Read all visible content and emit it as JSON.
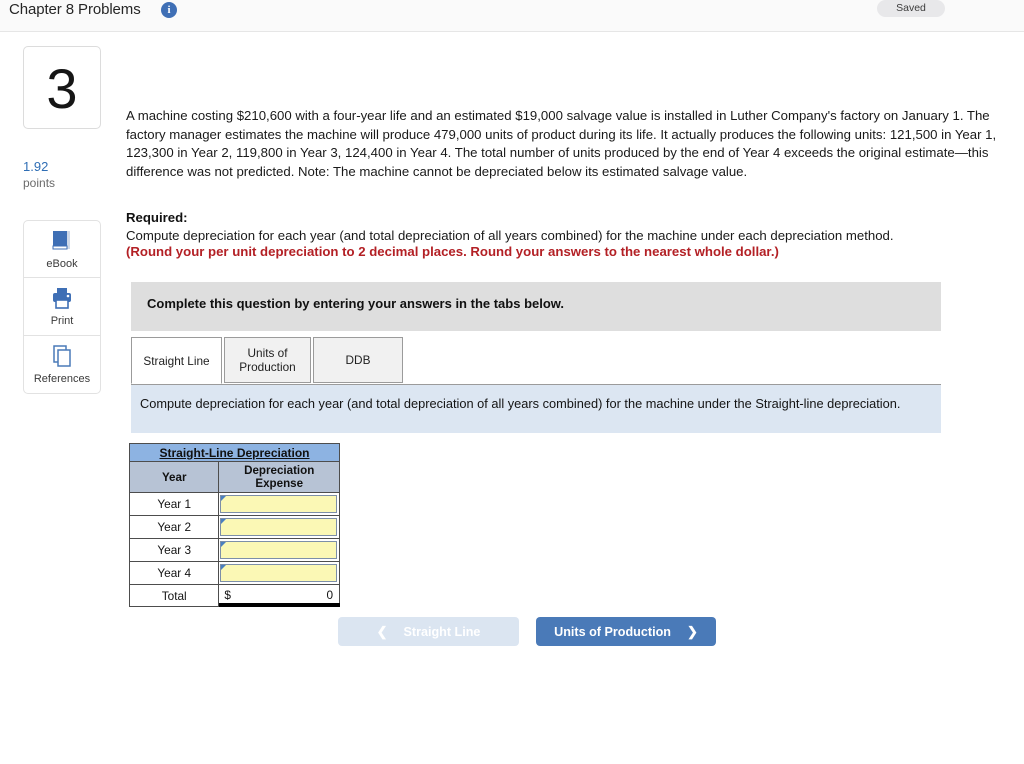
{
  "header": {
    "title": "Chapter 8 Problems",
    "info_icon": "info-icon",
    "saved_label": "Saved"
  },
  "sidebar": {
    "question_number": "3",
    "points_value": "1.92",
    "points_label": "points",
    "buttons": [
      {
        "label": "eBook",
        "icon": "book-icon"
      },
      {
        "label": "Print",
        "icon": "printer-icon"
      },
      {
        "label": "References",
        "icon": "copy-pages-icon"
      }
    ]
  },
  "question": {
    "body": "A machine costing $210,600 with a four-year life and an estimated $19,000 salvage value is installed in Luther Company's factory on January 1. The factory manager estimates the machine will produce 479,000 units of product during its life. It actually produces the following units: 121,500 in Year 1, 123,300 in Year 2, 119,800 in Year 3, 124,400 in Year 4. The total number of units produced by the end of Year 4 exceeds the original estimate—this difference was not predicted. Note: The machine cannot be depreciated below its estimated salvage value.",
    "required_heading": "Required:",
    "required_body": "Compute depreciation for each year (and total depreciation of all years combined) for the machine under each depreciation method.",
    "rounding_note": "(Round your per unit depreciation to 2 decimal places. Round your answers to the nearest whole dollar.)"
  },
  "complete_bar": {
    "text": "Complete this question by entering your answers in the tabs below."
  },
  "tabs": [
    {
      "label": "Straight Line",
      "active": true
    },
    {
      "label": "Units of Production",
      "active": false
    },
    {
      "label": "DDB",
      "active": false
    }
  ],
  "tab_instruction": {
    "text": "Compute depreciation for each year (and total depreciation of all years combined) for the machine under the Straight-line depreciation."
  },
  "answer_table": {
    "title": "Straight-Line Depreciation",
    "columns": [
      "Year",
      "Depreciation Expense"
    ],
    "rows": [
      {
        "year": "Year 1",
        "value": ""
      },
      {
        "year": "Year 2",
        "value": ""
      },
      {
        "year": "Year 3",
        "value": ""
      },
      {
        "year": "Year 4",
        "value": ""
      }
    ],
    "total_label": "Total",
    "total_currency": "$",
    "total_value": "0"
  },
  "nav": {
    "prev_label": "Straight Line",
    "prev_chevron": "chevron-left-icon",
    "prev_disabled": true,
    "next_label": "Units of Production",
    "next_chevron": "chevron-right-icon"
  },
  "colors": {
    "accent_blue": "#4a7ab8",
    "table_header_blue": "#8db3e2",
    "table_subheader_gray": "#b7c3d5",
    "input_yellow": "#fbf8b5",
    "instruction_blue": "#dce6f2",
    "complete_bar_gray": "#dedede",
    "warning_red": "#b32025"
  }
}
